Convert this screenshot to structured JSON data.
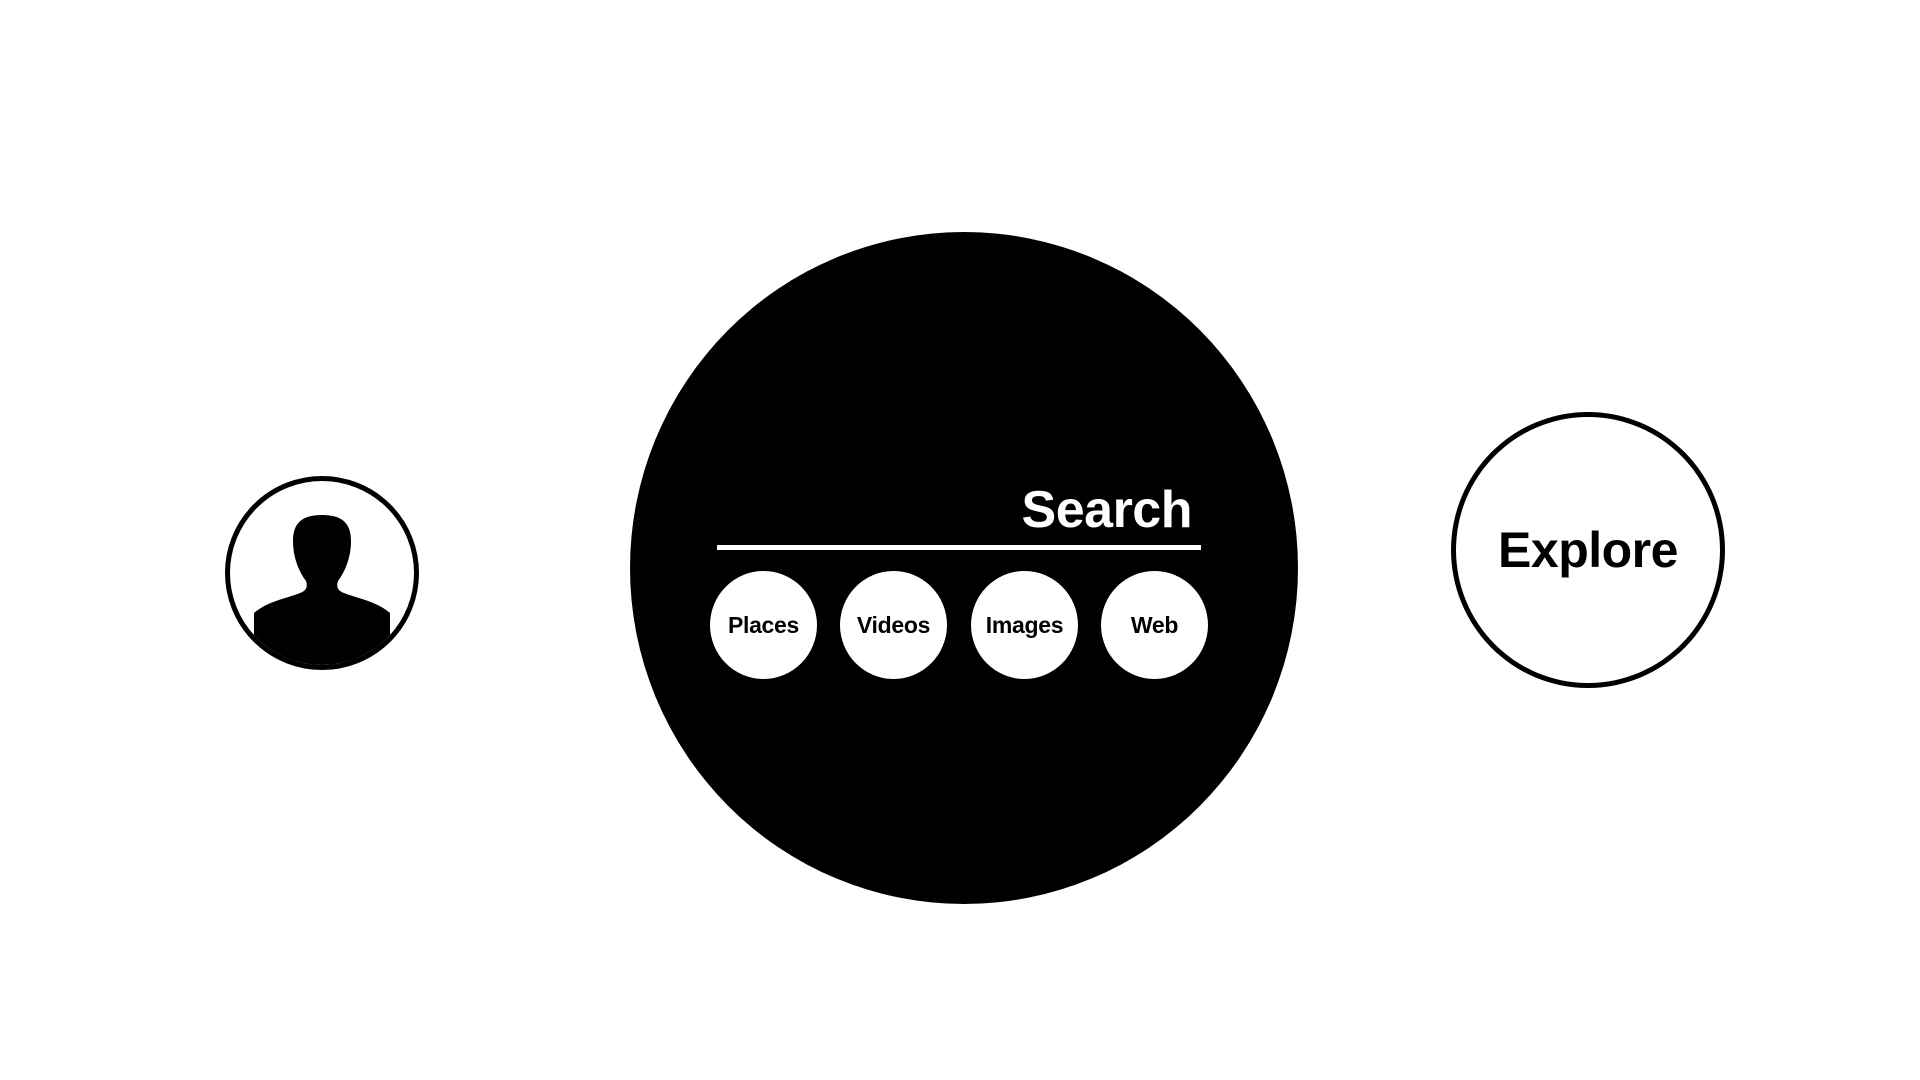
{
  "profile": {
    "icon": "user-silhouette-icon"
  },
  "search": {
    "label": "Search",
    "categories": [
      {
        "label": "Places"
      },
      {
        "label": "Videos"
      },
      {
        "label": "Images"
      },
      {
        "label": "Web"
      }
    ]
  },
  "explore": {
    "label": "Explore"
  },
  "colors": {
    "background": "#ffffff",
    "primary": "#000000"
  }
}
